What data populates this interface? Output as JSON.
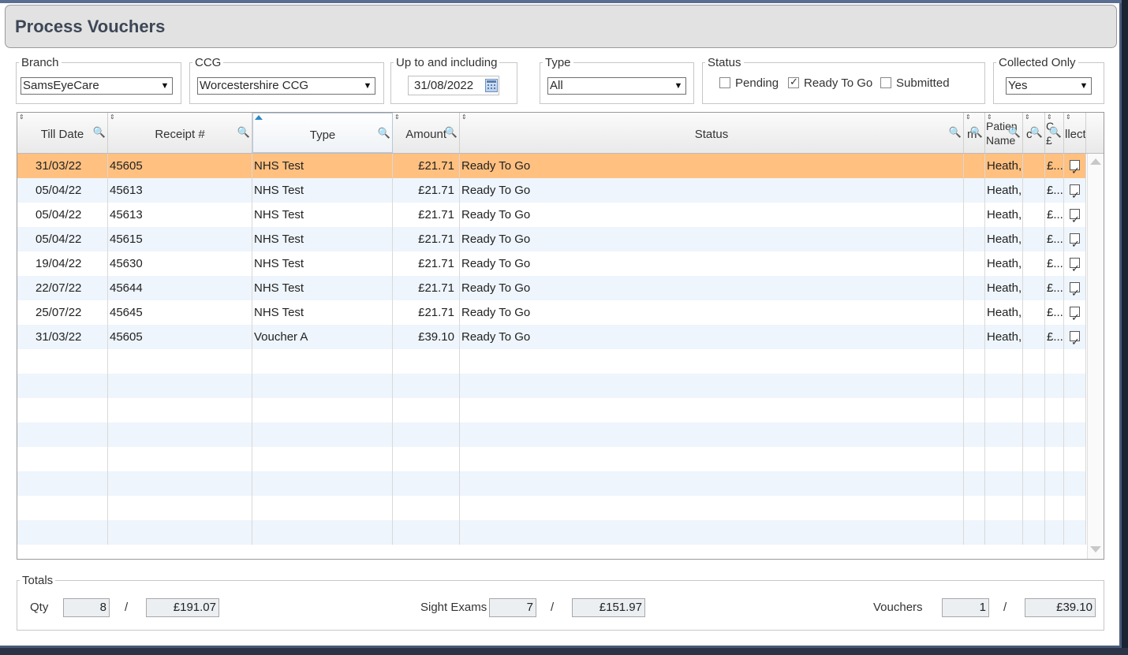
{
  "window": {
    "title": "Process Vouchers"
  },
  "filters": {
    "branch": {
      "label": "Branch",
      "value": "SamsEyeCare"
    },
    "ccg": {
      "label": "CCG",
      "value": "Worcestershire CCG"
    },
    "date": {
      "label": "Up to and including",
      "value": "31/08/2022"
    },
    "type": {
      "label": "Type",
      "value": "All"
    },
    "status": {
      "label": "Status",
      "options": [
        {
          "label": "Pending",
          "checked": false
        },
        {
          "label": "Ready To Go",
          "checked": true
        },
        {
          "label": "Submitted",
          "checked": false
        }
      ]
    },
    "collected_only": {
      "label": "Collected Only",
      "value": "Yes"
    }
  },
  "grid": {
    "columns": {
      "till_date": "Till Date",
      "receipt": "Receipt #",
      "type": "Type",
      "amount": "Amount",
      "status": "Status",
      "col_m": "m",
      "patient_name_1": "Patien",
      "patient_name_2": "Name",
      "col_c": "c",
      "col_pound_1": "C",
      "col_pound_2": "£",
      "collected": "llect"
    },
    "rows": [
      {
        "till_date": "31/03/22",
        "receipt": "45605",
        "type": "NHS Test",
        "amount": "£21.71",
        "status": "Ready To Go",
        "patient": "Heath,",
        "pound": "£...",
        "collected": true,
        "selected": true
      },
      {
        "till_date": "05/04/22",
        "receipt": "45613",
        "type": "NHS Test",
        "amount": "£21.71",
        "status": "Ready To Go",
        "patient": "Heath,",
        "pound": "£...",
        "collected": true
      },
      {
        "till_date": "05/04/22",
        "receipt": "45613",
        "type": "NHS Test",
        "amount": "£21.71",
        "status": "Ready To Go",
        "patient": "Heath,",
        "pound": "£...",
        "collected": true
      },
      {
        "till_date": "05/04/22",
        "receipt": "45615",
        "type": "NHS Test",
        "amount": "£21.71",
        "status": "Ready To Go",
        "patient": "Heath,",
        "pound": "£...",
        "collected": true
      },
      {
        "till_date": "19/04/22",
        "receipt": "45630",
        "type": "NHS Test",
        "amount": "£21.71",
        "status": "Ready To Go",
        "patient": "Heath,",
        "pound": "£...",
        "collected": true
      },
      {
        "till_date": "22/07/22",
        "receipt": "45644",
        "type": "NHS Test",
        "amount": "£21.71",
        "status": "Ready To Go",
        "patient": "Heath,",
        "pound": "£...",
        "collected": true
      },
      {
        "till_date": "25/07/22",
        "receipt": "45645",
        "type": "NHS Test",
        "amount": "£21.71",
        "status": "Ready To Go",
        "patient": "Heath,",
        "pound": "£...",
        "collected": true
      },
      {
        "till_date": "31/03/22",
        "receipt": "45605",
        "type": "Voucher A",
        "amount": "£39.10",
        "status": "Ready To Go",
        "patient": "Heath,",
        "pound": "£...",
        "collected": true
      }
    ]
  },
  "totals": {
    "label": "Totals",
    "qty": {
      "label": "Qty",
      "count": "8",
      "amount": "£191.07"
    },
    "sight_exams": {
      "label": "Sight Exams",
      "count": "7",
      "amount": "£151.97"
    },
    "vouchers": {
      "label": "Vouchers",
      "count": "1",
      "amount": "£39.10"
    },
    "separator": "/"
  },
  "colors": {
    "selected_row": "#ffc080",
    "alt_row": "#eef5fc",
    "search_icon": "#2e5fa7"
  }
}
